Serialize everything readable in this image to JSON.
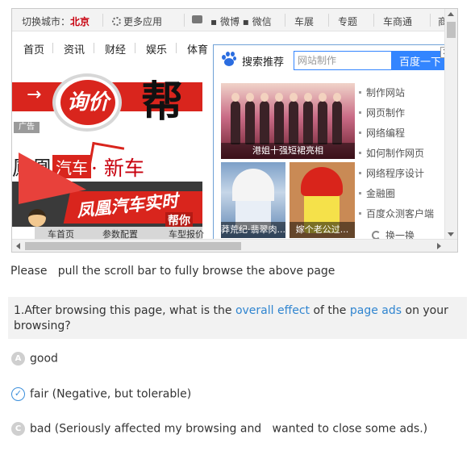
{
  "browser": {
    "topbar": {
      "city_label": "切换城市：",
      "city_value": "北京",
      "more_apps": "更多应用",
      "weibo": "▪ 微博 ▪ 微信",
      "chezhan": "车展",
      "zhuanti": "专题",
      "cheshang": "车商通",
      "cheshang_more": "商"
    },
    "nav": [
      "首页",
      "资讯",
      "财经",
      "娱乐",
      "体育"
    ],
    "ads": {
      "arrow": "→",
      "circle_text": "询价",
      "headline": "帮",
      "ad_tag": "广告",
      "brand_1": "鳳凰",
      "brand_chip": "汽车",
      "brand_2": "· 新车",
      "banner_text": "凤凰汽车实时",
      "banner_sub": "帮你",
      "tabs": [
        "车首页",
        "参数配置",
        "车型报价"
      ]
    },
    "popup": {
      "title": "搜索推荐",
      "search_placeholder": "网站制作",
      "search_button": "百度一下",
      "close": "✕",
      "thumb_main_caption": "港姐十强短裙亮相",
      "thumb_a_caption": "莽荒纪·翡翠肉...",
      "thumb_b_caption": "嫁个老公过...",
      "recommendations": [
        "制作网站",
        "网页制作",
        "网络编程",
        "如何制作网页",
        "网络程序设计",
        "金融圈",
        "百度众测客户端"
      ],
      "refresh": "换一换"
    }
  },
  "survey": {
    "instruction": "Please   pull the scroll bar to fully browse the above page",
    "question_prefix": "1.After browsing this page, what is the ",
    "question_hl1": "overall effect",
    "question_mid": " of the ",
    "question_hl2": "page ads",
    "question_suffix": " on your browsing?",
    "options": [
      {
        "mark": "A",
        "text": "good",
        "selected": false
      },
      {
        "mark": "✓",
        "text": "fair (Negative, but tolerable)",
        "selected": true
      },
      {
        "mark": "C",
        "text": "bad (Seriously affected my browsing and   wanted to close some ads.)",
        "selected": false
      }
    ]
  },
  "colors": {
    "accent_blue": "#3385ff",
    "brand_red": "#d9251d",
    "highlight_text": "#3085d0"
  }
}
